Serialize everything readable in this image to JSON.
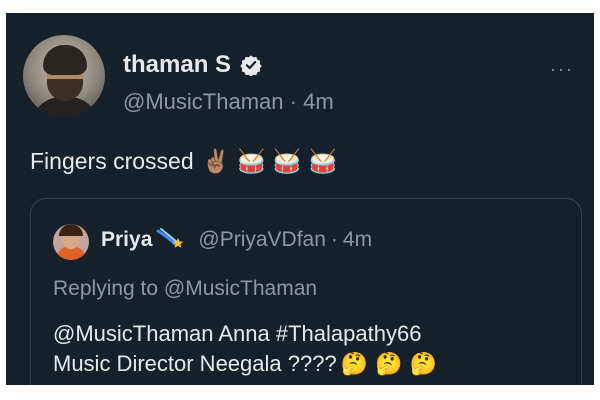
{
  "tweet": {
    "author_name": "thaman S",
    "author_handle": "@MusicThaman",
    "separator": "·",
    "time_ago": "4m",
    "text": "Fingers crossed",
    "emojis": [
      "✌🏽",
      "🥁",
      "🥁",
      "🥁"
    ],
    "more_icon": "···"
  },
  "quote": {
    "author_name": "Priya",
    "author_handle": "@PriyaVDfan",
    "separator": "·",
    "time_ago": "4m",
    "replying_to": "Replying to @MusicThaman",
    "line1": "@MusicThaman Anna #Thalapathy66",
    "line2": "Music Director Neegala ????",
    "emojis": [
      "🤔",
      "🤔",
      "🤔"
    ]
  },
  "colors": {
    "background": "#15202b",
    "primary_text": "#e7e9ea",
    "secondary_text": "#8b98a5",
    "border": "#38444d"
  }
}
